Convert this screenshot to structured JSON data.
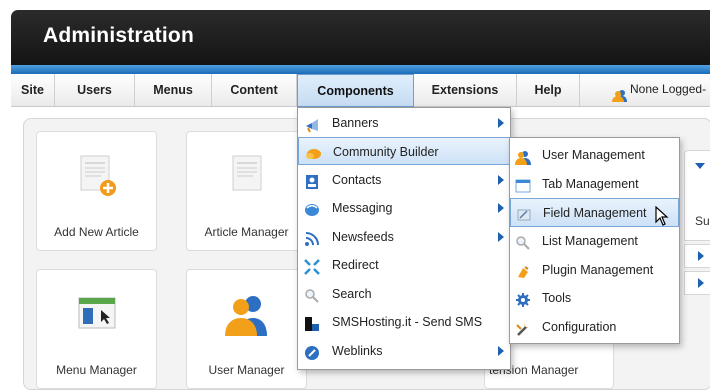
{
  "header": {
    "title": "Administration"
  },
  "menubar": {
    "items": [
      "Site",
      "Users",
      "Menus",
      "Content",
      "Components",
      "Extensions",
      "Help"
    ],
    "active": "Components",
    "login_status": "None Logged-"
  },
  "cards": {
    "add_article": "Add New Article",
    "article_manager": "Article Manager",
    "menu_manager": "Menu Manager",
    "user_manager": "User Manager",
    "extension_manager_partial": "tension Manager"
  },
  "right_col": {
    "su_partial": "Su"
  },
  "components_menu": {
    "items": [
      {
        "label": "Banners",
        "icon": "banners-icon",
        "has_submenu": true
      },
      {
        "label": "Community Builder",
        "icon": "community-builder-icon",
        "has_submenu": true
      },
      {
        "label": "Contacts",
        "icon": "contacts-icon",
        "has_submenu": true
      },
      {
        "label": "Messaging",
        "icon": "messaging-icon",
        "has_submenu": true
      },
      {
        "label": "Newsfeeds",
        "icon": "newsfeeds-icon",
        "has_submenu": true
      },
      {
        "label": "Redirect",
        "icon": "redirect-icon",
        "has_submenu": false
      },
      {
        "label": "Search",
        "icon": "search-icon",
        "has_submenu": false
      },
      {
        "label": "SMSHosting.it - Send SMS",
        "icon": "sms-icon",
        "has_submenu": false
      },
      {
        "label": "Weblinks",
        "icon": "weblinks-icon",
        "has_submenu": true
      }
    ],
    "highlighted": "Community Builder"
  },
  "community_builder_submenu": {
    "items": [
      {
        "label": "User Management",
        "icon": "user-management-icon"
      },
      {
        "label": "Tab Management",
        "icon": "tab-management-icon"
      },
      {
        "label": "Field Management",
        "icon": "field-management-icon"
      },
      {
        "label": "List Management",
        "icon": "list-management-icon"
      },
      {
        "label": "Plugin Management",
        "icon": "plugin-management-icon"
      },
      {
        "label": "Tools",
        "icon": "tools-icon"
      },
      {
        "label": "Configuration",
        "icon": "configuration-icon"
      }
    ],
    "highlighted": "Field Management"
  },
  "colors": {
    "accent": "#1b6db8",
    "header_bg": "#1c1c1c",
    "highlight": "#cde1f6"
  }
}
